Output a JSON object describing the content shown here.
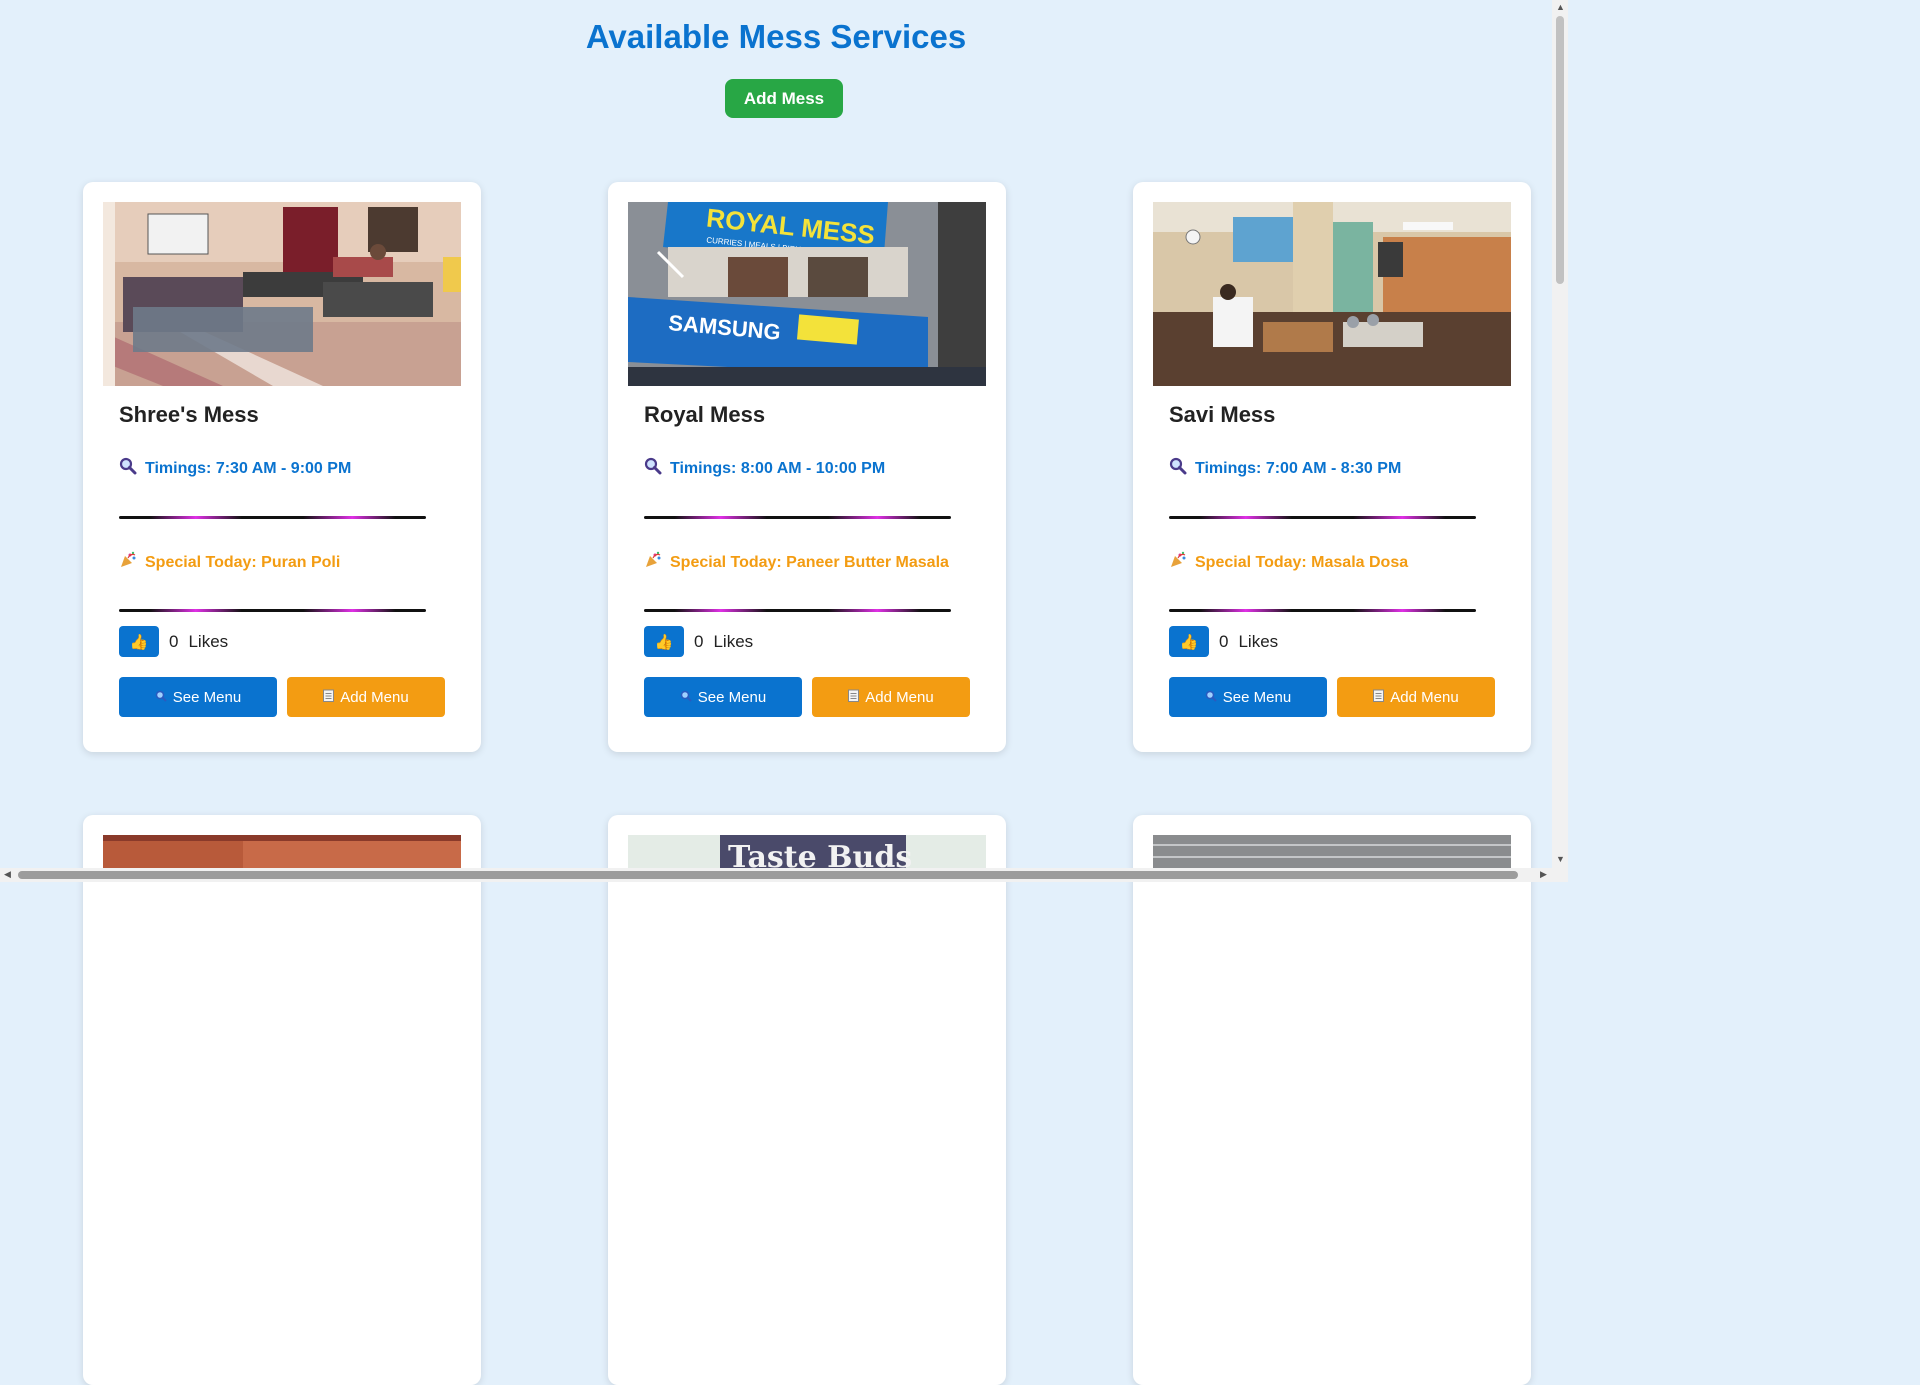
{
  "page": {
    "title": "Available Mess Services",
    "add_mess_label": "Add Mess"
  },
  "icons": {
    "timing": "magnifier-icon",
    "special": "party-popper-icon",
    "like": "thumbs-up-icon",
    "see_menu": "magnifier-icon",
    "add_menu": "notepad-icon"
  },
  "colors": {
    "title": "#0a73cf",
    "add_mess": "#28a745",
    "see_menu": "#0a73cf",
    "add_menu": "#f39c12",
    "special": "#f39c12"
  },
  "messes": [
    {
      "name": "Shree's Mess",
      "timings": "Timings: 7:30 AM - 9:00 PM",
      "special": "Special Today: Puran Poli",
      "likes_count": "0",
      "likes_label": "Likes",
      "see_menu_label": "See Menu",
      "add_menu_label": "Add Menu"
    },
    {
      "name": "Royal Mess",
      "timings": "Timings: 8:00 AM - 10:00 PM",
      "special": "Special Today: Paneer Butter Masala",
      "likes_count": "0",
      "likes_label": "Likes",
      "see_menu_label": "See Menu",
      "add_menu_label": "Add Menu",
      "image_sign_text": "ROYAL MESS",
      "image_sign_subtext": "CURRIES | MEALS | BIRYANI'S | CATERING",
      "image_sign_samsung": "SAMSUNG"
    },
    {
      "name": "Savi Mess",
      "timings": "Timings: 7:00 AM - 8:30 PM",
      "special": "Special Today: Masala Dosa",
      "likes_count": "0",
      "likes_label": "Likes",
      "see_menu_label": "See Menu",
      "add_menu_label": "Add Menu"
    }
  ],
  "next_row": {
    "middle_image_text": "Taste Buds"
  }
}
